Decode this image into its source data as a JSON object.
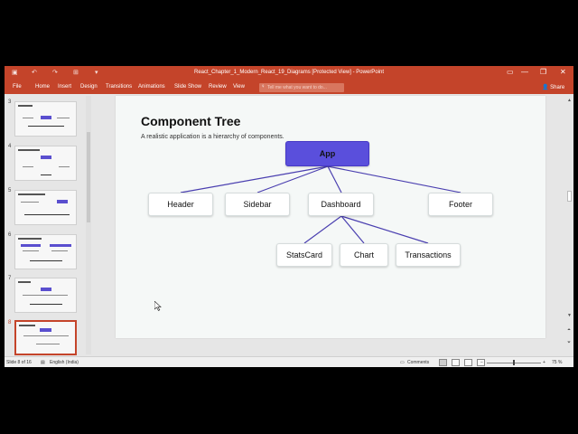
{
  "window": {
    "title": "React_Chapter_1_Modern_React_19_Diagrams [Protected View] - PowerPoint"
  },
  "ribbon": {
    "tabs": [
      "File",
      "Home",
      "Insert",
      "Design",
      "Transitions",
      "Animations",
      "Slide Show",
      "Review",
      "View"
    ],
    "tell_me_placeholder": "Tell me what you want to do...",
    "share_label": "Share"
  },
  "thumbnails": [
    {
      "number": "3",
      "selected": false
    },
    {
      "number": "4",
      "selected": false
    },
    {
      "number": "5",
      "selected": false
    },
    {
      "number": "6",
      "selected": false
    },
    {
      "number": "7",
      "selected": false
    },
    {
      "number": "8",
      "selected": true
    }
  ],
  "slide": {
    "title": "Component Tree",
    "subtitle": "A realistic application is a hierarchy of components.",
    "nodes": {
      "root": "App",
      "header": "Header",
      "sidebar": "Sidebar",
      "dashboard": "Dashboard",
      "footer": "Footer",
      "statscard": "StatsCard",
      "chart": "Chart",
      "transactions": "Transactions"
    }
  },
  "status": {
    "slide_indicator": "Slide 8 of 16",
    "language": "English (India)",
    "comments_label": "Comments",
    "zoom": "75 %"
  },
  "colors": {
    "ribbon": "#c4442a",
    "root_node": "#5a4fdc",
    "edge": "#4a3fb0"
  }
}
